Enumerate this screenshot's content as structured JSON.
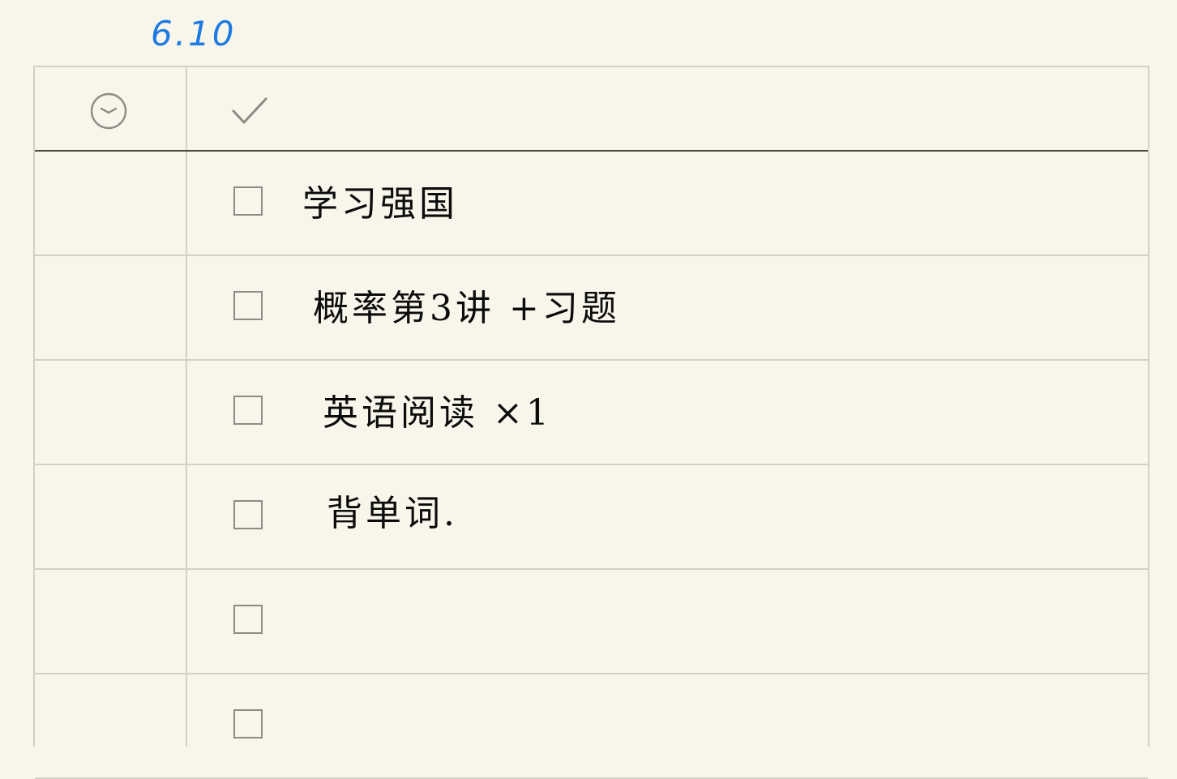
{
  "date": "6.10",
  "header": {
    "time_icon": "clock-icon",
    "done_icon": "checkmark-icon"
  },
  "tasks": [
    {
      "text": "学习强国",
      "checked": false
    },
    {
      "text": "概率第3讲 +习题",
      "checked": false
    },
    {
      "text": "英语阅读 ×1",
      "checked": false
    },
    {
      "text": "背单词.",
      "checked": false
    },
    {
      "text": "",
      "checked": false
    },
    {
      "text": "",
      "checked": false
    }
  ],
  "colors": {
    "paper": "#f8f6ea",
    "grid_line": "#d3d1c6",
    "header_rule": "#4a4944",
    "ink": "#0c0c0c",
    "date_ink": "#1c7ae3"
  }
}
